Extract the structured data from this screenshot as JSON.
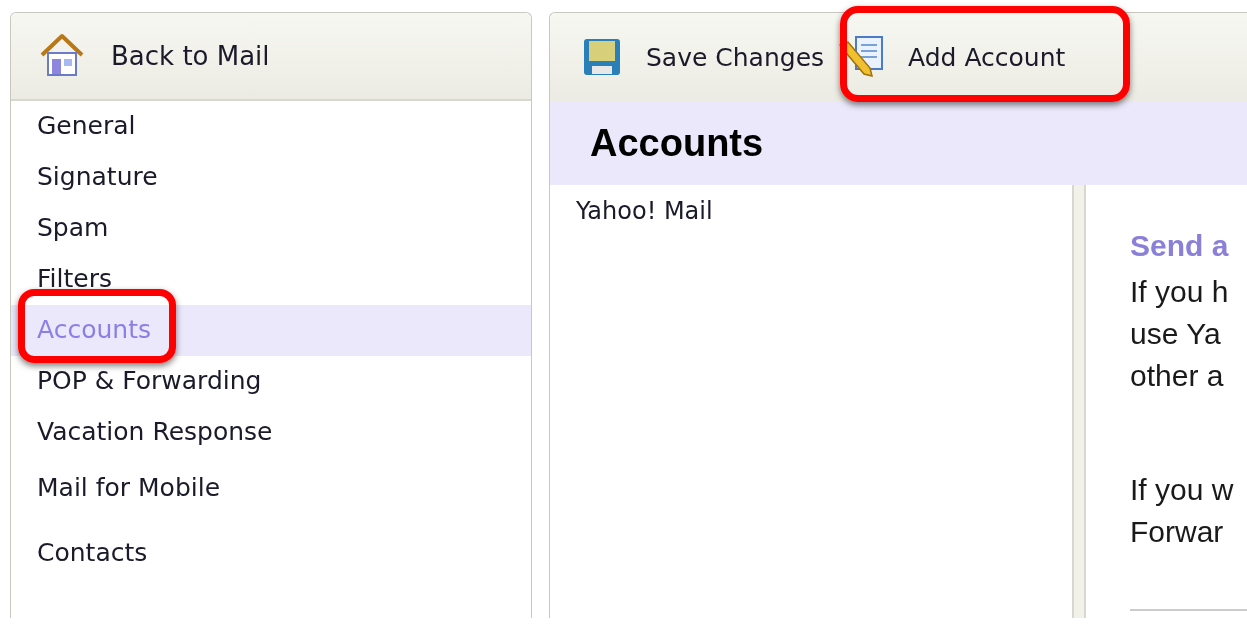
{
  "sidebar": {
    "back_button": {
      "label": "Back to Mail"
    },
    "items": [
      {
        "label": "General",
        "selected": false
      },
      {
        "label": "Signature",
        "selected": false
      },
      {
        "label": "Spam",
        "selected": false
      },
      {
        "label": "Filters",
        "selected": false
      },
      {
        "label": "Accounts",
        "selected": true
      },
      {
        "label": "POP & Forwarding",
        "selected": false
      },
      {
        "label": "Vacation Response",
        "selected": false
      },
      {
        "label": "Mail for Mobile",
        "selected": false
      },
      {
        "label": "Contacts",
        "selected": false
      }
    ]
  },
  "toolbar": {
    "buttons": [
      {
        "kind": "save",
        "label": "Save Changes"
      },
      {
        "kind": "add",
        "label": "Add Account"
      }
    ]
  },
  "page_title": "Accounts",
  "account_list": [
    "Yahoo! Mail"
  ],
  "detail": {
    "heading": "Send a",
    "paragraphs": [
      [
        "If you h",
        "use Ya",
        "other a"
      ],
      [
        "If you w",
        "Forwar"
      ]
    ]
  }
}
